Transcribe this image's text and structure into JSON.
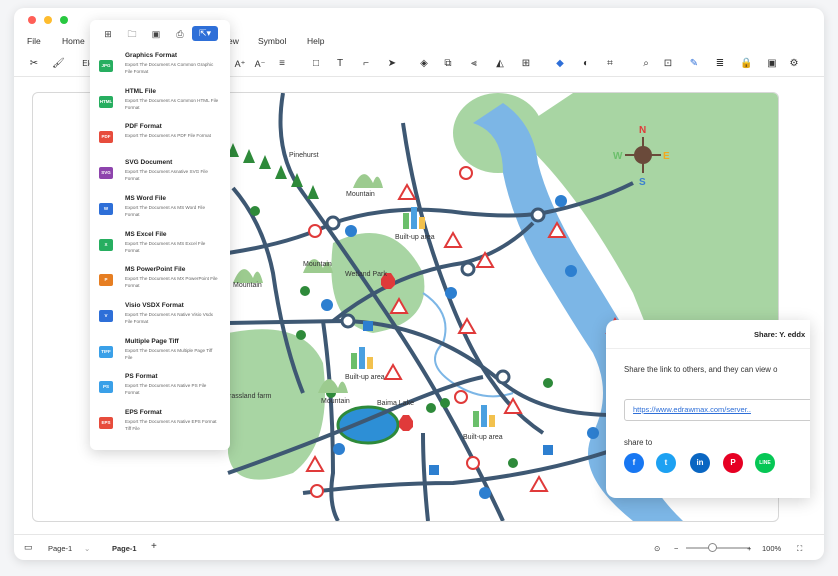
{
  "menu": {
    "file": "File",
    "home": "Home",
    "view_partial": "ew",
    "symbol": "Symbol",
    "help": "Help"
  },
  "toolbar": {
    "font_partial": "Ele"
  },
  "export_menu": {
    "items": [
      {
        "badge": "JPG",
        "title": "Graphics Format",
        "desc": "Export The Document As Common Graphic File Format",
        "color": "#27ae60"
      },
      {
        "badge": "HTML",
        "title": "HTML File",
        "desc": "Export The Document As Common HTML File Format",
        "color": "#27ae60"
      },
      {
        "badge": "PDF",
        "title": "PDF Format",
        "desc": "Export The Document As PDF File Format",
        "color": "#e74c3c"
      },
      {
        "badge": "SVG",
        "title": "SVG Document",
        "desc": "Export The Document Asnative SVG File Format",
        "color": "#8e44ad"
      },
      {
        "badge": "W",
        "title": "MS Word File",
        "desc": "Export The Document As MS Word File Format",
        "color": "#2e6fd8"
      },
      {
        "badge": "X",
        "title": "MS Excel File",
        "desc": "Export The Document As MS Excel File Format",
        "color": "#27ae60"
      },
      {
        "badge": "P",
        "title": "MS PowerPoint File",
        "desc": "Export The Document As MX PowerPoint File Format",
        "color": "#e67e22"
      },
      {
        "badge": "V",
        "title": "Visio VSDX Format",
        "desc": "Export The Document As Native Visio Vsdx File Format",
        "color": "#2e6fd8"
      },
      {
        "badge": "TIFF",
        "title": "Multiple Page Tiff",
        "desc": "Export The Document As Multiple Page Tiff File",
        "color": "#3aa0e8"
      },
      {
        "badge": "PS",
        "title": "PS Format",
        "desc": "Export The Document As Native PS File Format",
        "color": "#3aa0e8"
      },
      {
        "badge": "EPS",
        "title": "EPS Format",
        "desc": "Export The Document As Native EPS Format Tiff File",
        "color": "#e74c3c"
      }
    ]
  },
  "map": {
    "labels": {
      "pinehurst": "Pinehurst",
      "mountain1": "Mountain",
      "mountain2": "Mountain",
      "mountain3": "Mountain",
      "mountain4": "Mountain",
      "builtup1": "Built-up area",
      "builtup2": "Built-up area",
      "builtup3": "Built-up area",
      "wetland": "Wetland Park",
      "grassland": "rassland farm",
      "baima": "Baima Lake"
    },
    "compass": {
      "n": "N",
      "s": "S",
      "e": "E",
      "w": "W"
    }
  },
  "share": {
    "title": "Share: Y. eddx",
    "desc": "Share the link to others, and they can view o",
    "link": "https://www.edrawmax.com/server..",
    "share_to": "share to"
  },
  "status": {
    "page_select": "Page-1",
    "page_tab": "Page-1",
    "add": "+",
    "zoom": "100%"
  }
}
